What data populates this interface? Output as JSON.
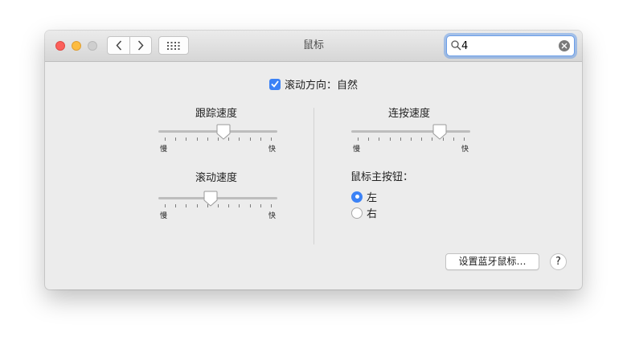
{
  "window": {
    "title": "鼠标"
  },
  "titlebar": {
    "icons": [
      "close-icon",
      "minimize-icon",
      "zoom-icon",
      "back-icon",
      "forward-icon",
      "show-all-grid-icon",
      "search-icon",
      "clear-icon"
    ]
  },
  "search": {
    "value": "4",
    "placeholder": ""
  },
  "scroll_direction": {
    "label": "滚动方向：自然",
    "checked": true
  },
  "tracking_speed": {
    "label": "跟踪速度",
    "slow": "慢",
    "fast": "快",
    "level": 0.55
  },
  "scroll_speed": {
    "label": "滚动速度",
    "slow": "慢",
    "fast": "快",
    "level": 0.43
  },
  "double_click_speed": {
    "label": "连按速度",
    "slow": "慢",
    "fast": "快",
    "level": 0.77
  },
  "primary_button": {
    "title": "鼠标主按钮：",
    "options": [
      {
        "label": "左",
        "selected": true
      },
      {
        "label": "右",
        "selected": false
      }
    ]
  },
  "bluetooth_button": {
    "label": "设置蓝牙鼠标…"
  },
  "help_button": {
    "label": "?"
  },
  "colors": {
    "accent": "#3b82f6",
    "focus_ring": "#6b9ee8",
    "close": "#fc605b",
    "minimize": "#fdbc40"
  }
}
